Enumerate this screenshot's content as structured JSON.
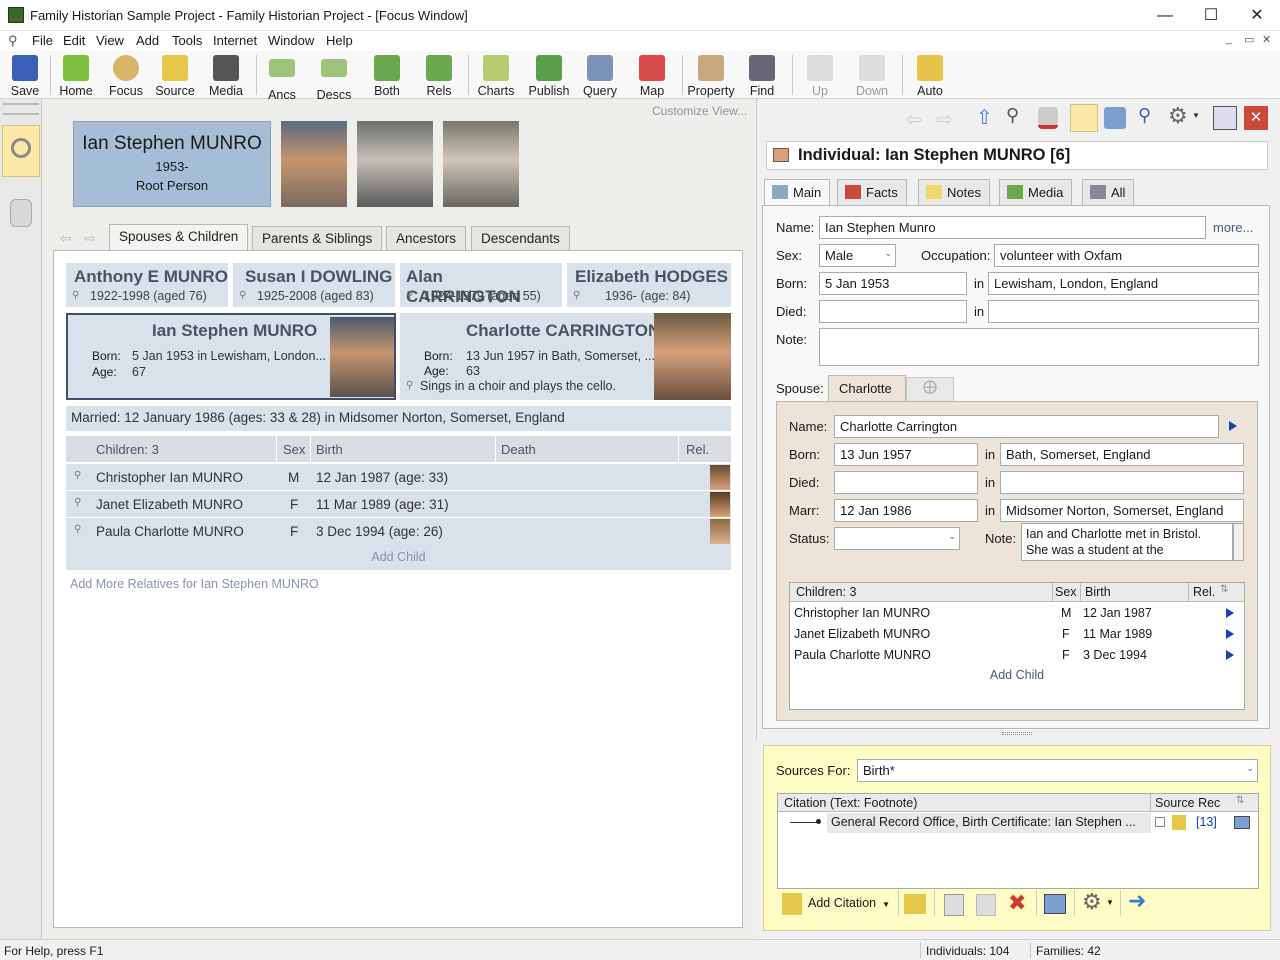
{
  "window": {
    "title": "Family Historian Sample Project - Family Historian Project - [Focus Window]"
  },
  "menu": [
    "File",
    "Edit",
    "View",
    "Add",
    "Tools",
    "Internet",
    "Window",
    "Help"
  ],
  "toolbar": {
    "save": "Save",
    "home": "Home",
    "focus": "Focus",
    "source": "Source",
    "media": "Media",
    "ancs": "Ancs",
    "descs": "Descs",
    "both": "Both",
    "rels": "Rels",
    "charts": "Charts",
    "publish": "Publish",
    "query": "Query",
    "map": "Map",
    "property": "Property",
    "find": "Find",
    "up": "Up",
    "down": "Down",
    "auto": "Auto"
  },
  "focus": {
    "customize": "Customize View...",
    "root": {
      "name": "Ian Stephen MUNRO",
      "years": "1953-",
      "tag": "Root Person"
    },
    "tabs": [
      "Spouses & Children",
      "Parents & Siblings",
      "Ancestors",
      "Descendants"
    ],
    "parents": [
      {
        "name": "Anthony E MUNRO",
        "dates": "1922-1998 (aged 76)"
      },
      {
        "name": "Susan I DOWLING",
        "dates": "1925-2008 (aged 83)"
      },
      {
        "name": "Alan CARRINGTON",
        "dates": "1924-1979 (aged 55)"
      },
      {
        "name": "Elizabeth HODGES",
        "dates": "1936-  (age: 84)"
      }
    ],
    "person": {
      "name": "Ian Stephen MUNRO",
      "born_label": "Born:",
      "born": "5 Jan 1953 in Lewisham, London...",
      "age_label": "Age:",
      "age": "67"
    },
    "spouse": {
      "name": "Charlotte CARRINGTON",
      "born_label": "Born:",
      "born": "13 Jun 1957 in Bath, Somerset, ...",
      "age_label": "Age:",
      "age": "63",
      "note": "Sings in a choir and plays the cello."
    },
    "married": "Married: 12 January 1986 (ages: 33 & 28) in Midsomer Norton, Somerset, England",
    "children_headers": [
      "Children: 3",
      "Sex",
      "Birth",
      "Death",
      "Rel."
    ],
    "children": [
      {
        "name": "Christopher Ian MUNRO",
        "sex": "M",
        "birth": "12 Jan 1987 (age: 33)"
      },
      {
        "name": "Janet Elizabeth MUNRO",
        "sex": "F",
        "birth": "11 Mar 1989 (age: 31)"
      },
      {
        "name": "Paula Charlotte MUNRO",
        "sex": "F",
        "birth": "3 Dec 1994 (age: 26)"
      }
    ],
    "add_child": "Add Child",
    "add_more": "Add More Relatives for Ian Stephen MUNRO"
  },
  "property": {
    "header": "Individual: Ian Stephen MUNRO [6]",
    "tabs": [
      "Main",
      "Facts",
      "Notes",
      "Media",
      "All"
    ],
    "name_label": "Name:",
    "name": "Ian Stephen Munro",
    "more": "more...",
    "sex_label": "Sex:",
    "sex": "Male",
    "occ_label": "Occupation:",
    "occupation": "volunteer with Oxfam",
    "born_label": "Born:",
    "born": "5 Jan 1953",
    "in": "in",
    "born_place": "Lewisham, London, England",
    "died_label": "Died:",
    "note_label": "Note:",
    "spouse_label": "Spouse:",
    "spouse_tab": "Charlotte",
    "sp_name": "Charlotte Carrington",
    "sp_born": "13 Jun 1957",
    "sp_born_place": "Bath, Somerset, England",
    "marr_label": "Marr:",
    "marr": "12 Jan 1986",
    "marr_place": "Midsomer Norton, Somerset, England",
    "status_label": "Status:",
    "sp_note": "Ian and Charlotte met in Bristol. She was a student at the",
    "children_headers": [
      "Children: 3",
      "Sex",
      "Birth",
      "Rel."
    ],
    "children": [
      {
        "name": "Christopher Ian MUNRO",
        "sex": "M",
        "birth": "12 Jan 1987"
      },
      {
        "name": "Janet Elizabeth MUNRO",
        "sex": "F",
        "birth": "11 Mar 1989"
      },
      {
        "name": "Paula Charlotte MUNRO",
        "sex": "F",
        "birth": "3 Dec 1994"
      }
    ],
    "add_child": "Add Child"
  },
  "sources": {
    "label": "Sources For:",
    "value": "Birth*",
    "col1": "Citation (Text: Footnote)",
    "col2": "Source Rec",
    "citation": "General Record Office, Birth Certificate: Ian Stephen ...",
    "rec": "[13]",
    "add_citation": "Add Citation"
  },
  "status": {
    "help": "For Help, press F1",
    "individuals": "Individuals: 104",
    "families": "Families: 42"
  }
}
